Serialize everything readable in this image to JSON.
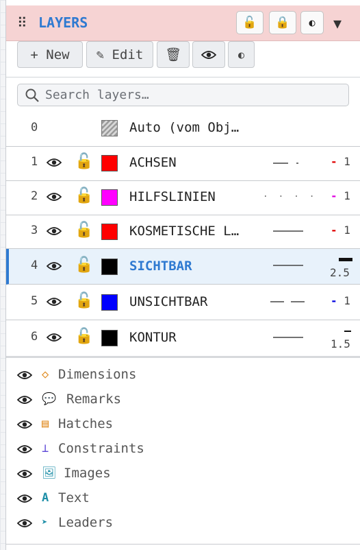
{
  "header": {
    "title": "LAYERS",
    "collapse_icon": "▼"
  },
  "toolbar": {
    "new_label": "+ New",
    "edit_label": "✎ Edit"
  },
  "search": {
    "placeholder": "Search layers…"
  },
  "layers": [
    {
      "num": "0",
      "name": "Auto (vom Obj…",
      "color": "auto"
    },
    {
      "num": "1",
      "name": "ACHSEN",
      "color": "#ff0000",
      "linetype": "dash-dot",
      "weight": "1"
    },
    {
      "num": "2",
      "name": "HILFSLINIEN",
      "color": "#ff00ff",
      "linetype": "dotted",
      "weight": "1"
    },
    {
      "num": "3",
      "name": "KOSMETISCHE L…",
      "color": "#ff0000",
      "linetype": "solid",
      "weight": "1"
    },
    {
      "num": "4",
      "name": "SICHTBAR",
      "color": "#000000",
      "linetype": "solid",
      "weight": "2.5",
      "selected": true
    },
    {
      "num": "5",
      "name": "UNSICHTBAR",
      "color": "#0000ff",
      "linetype": "dashed",
      "weight": "1"
    },
    {
      "num": "6",
      "name": "KONTUR",
      "color": "#000000",
      "linetype": "solid",
      "weight": "1.5"
    }
  ],
  "categories": [
    {
      "icon": "◇",
      "icon_color": "#e08a1e",
      "label": "Dimensions"
    },
    {
      "icon": "💬",
      "icon_color": "#444444",
      "label": "Remarks"
    },
    {
      "icon": "▤",
      "icon_color": "#e08a1e",
      "label": "Hatches"
    },
    {
      "icon": "⊥",
      "icon_color": "#5b46d6",
      "label": "Constraints"
    },
    {
      "icon": "🖼",
      "icon_color": "#1e8fa8",
      "label": "Images"
    },
    {
      "icon": "A",
      "icon_color": "#1e8fa8",
      "label": "Text"
    },
    {
      "icon": "➤",
      "icon_color": "#1e8fa8",
      "label": "Leaders"
    }
  ]
}
